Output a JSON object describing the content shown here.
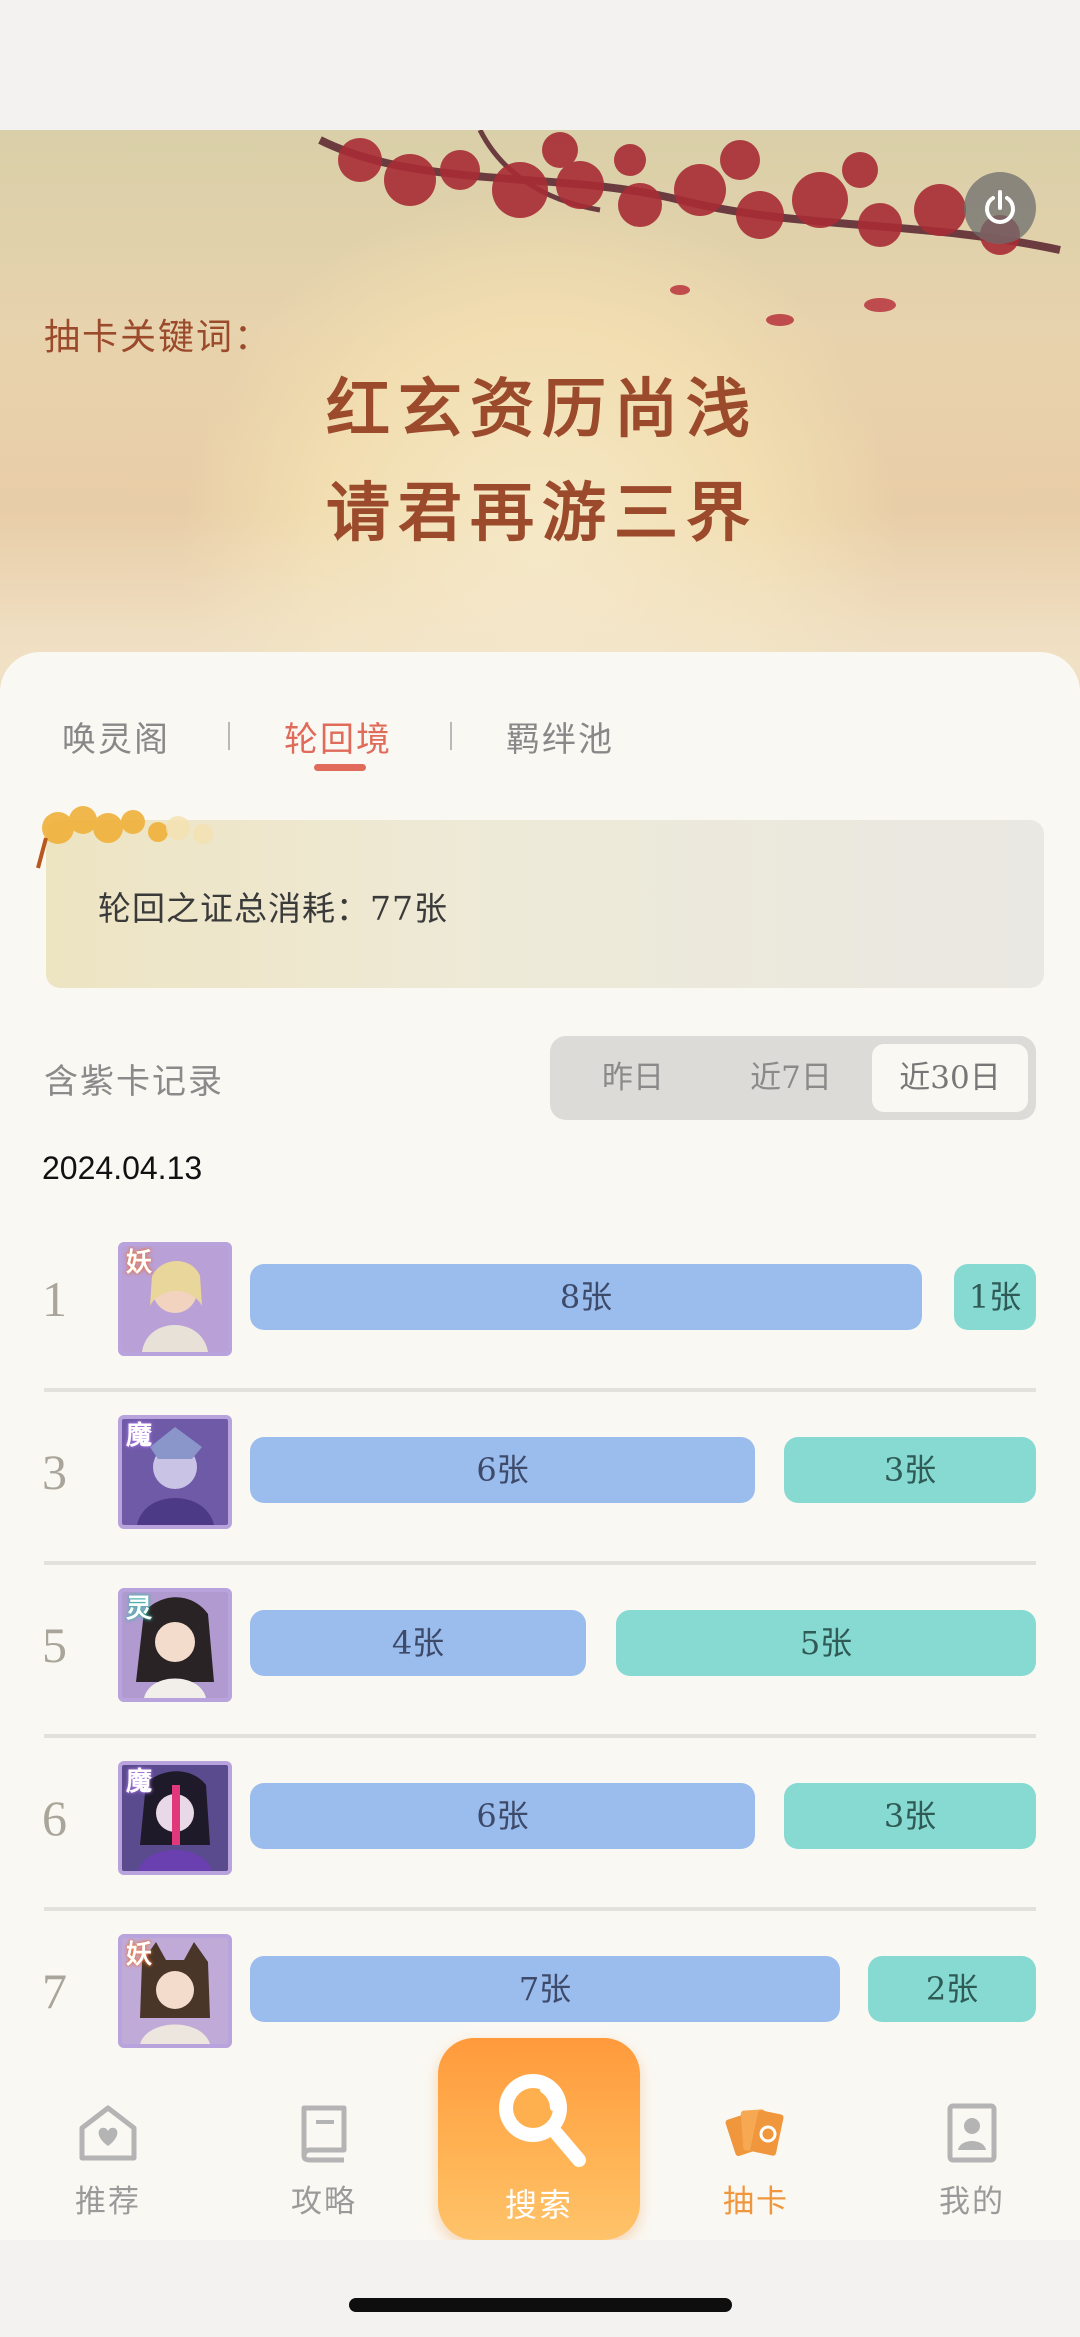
{
  "hero": {
    "keyword_label": "抽卡关键词：",
    "line1": "红玄资历尚浅",
    "line2": "请君再游三界"
  },
  "tabs": [
    "唤灵阁",
    "轮回境",
    "羁绊池"
  ],
  "active_tab": "轮回境",
  "stat": {
    "text": "轮回之证总消耗：77张"
  },
  "records": {
    "title": "含紫卡记录",
    "filters": [
      "昨日",
      "近7日",
      "近30日"
    ],
    "selected_filter": "近30日",
    "date": "2024.04.13"
  },
  "rows": [
    {
      "rank": "1",
      "badge": "妖",
      "badge_color": "#e8743a",
      "blue": "8张",
      "teal": "1张"
    },
    {
      "rank": "3",
      "badge": "魔",
      "badge_color": "#a874e0",
      "blue": "6张",
      "teal": "3张"
    },
    {
      "rank": "5",
      "badge": "灵",
      "badge_color": "#3cb5a8",
      "blue": "4张",
      "teal": "5张"
    },
    {
      "rank": "6",
      "badge": "魔",
      "badge_color": "#a874e0",
      "blue": "6张",
      "teal": "3张"
    },
    {
      "rank": "7",
      "badge": "妖",
      "badge_color": "#e8743a",
      "blue": "7张",
      "teal": "2张"
    }
  ],
  "nav": {
    "items": [
      "推荐",
      "攻略",
      "搜索",
      "抽卡",
      "我的"
    ],
    "active": "抽卡"
  },
  "colors": {
    "accent": "#e06b5a",
    "nav_active": "#f0963c",
    "bar_blue": "#9bbdee",
    "bar_teal": "#86dad2"
  }
}
